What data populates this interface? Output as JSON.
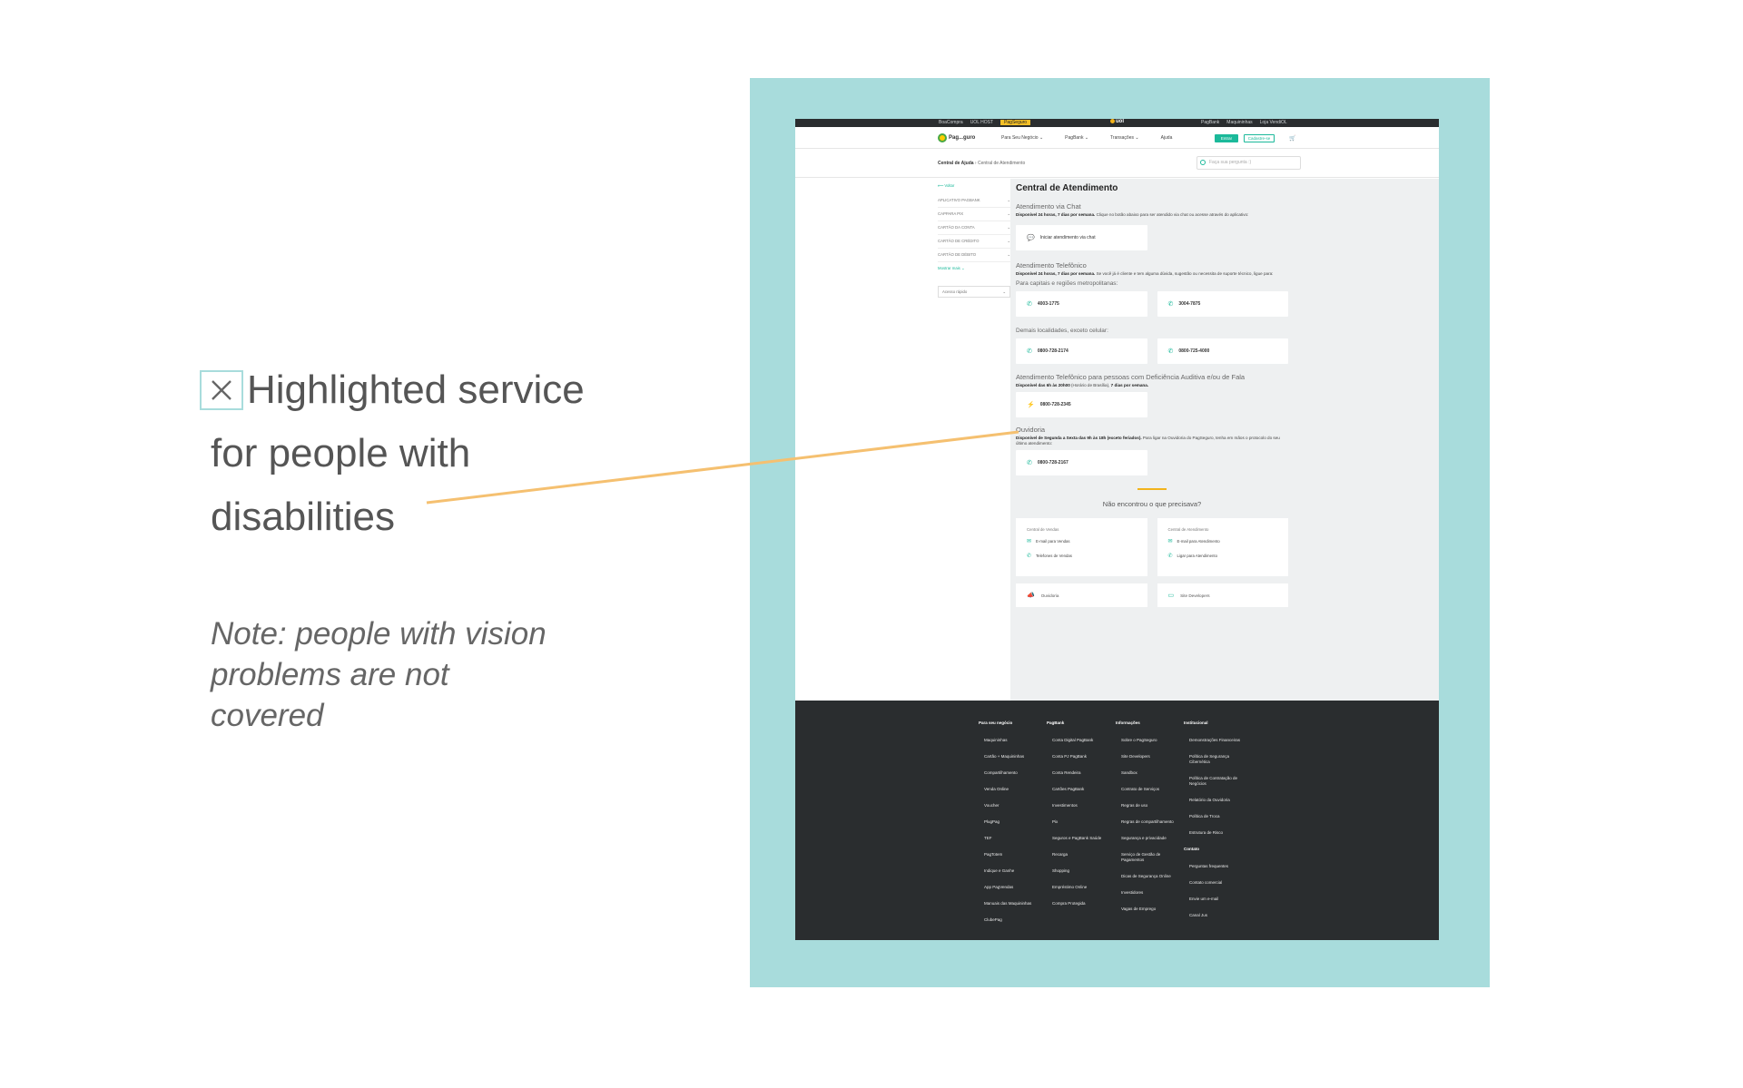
{
  "annotation": {
    "line1": "Highlighted service",
    "line2": "for people with",
    "line3": "disabilities",
    "note": "Note: people with vision problems are not covered",
    "colors": {
      "frame": "#a8dcdc",
      "connector": "#f5c070",
      "text": "#555555"
    }
  },
  "topbar": {
    "left_links": [
      "BoaCompra",
      "UOL HOST",
      "PagSeguro"
    ],
    "logo": "uol",
    "right_links": [
      "PagBank",
      "Maquininhas",
      "Loja VendiOL"
    ]
  },
  "header": {
    "brand": "Pag...guro",
    "nav": [
      "Para Seu Negócio ⌄",
      "PagBank ⌄",
      "Transações ⌄",
      "Ajuda"
    ],
    "login_label": "Entrar",
    "signup_label": "Cadastre-se",
    "cart_icon": "cart-icon"
  },
  "subheader": {
    "breadcrumb_root": "Central de Ajuda",
    "breadcrumb_current": "Central de Atendimento",
    "search_placeholder": "Faça sua pergunta :)"
  },
  "sidebar": {
    "back": "⟵ Voltar",
    "items": [
      "APLICATIVO PAGBANK",
      "CAPPARA PIX",
      "CARTÃO DA CONTA",
      "CARTÃO DE CRÉDITO",
      "CARTÃO DE DÉBITO"
    ],
    "more": "Mostrar mais ⌄",
    "select_value": "Acesso rápido"
  },
  "main": {
    "title": "Central de Atendimento",
    "chat": {
      "title": "Atendimento via Chat",
      "desc_bold": "Disponível 24 horas, 7 dias por semana.",
      "desc": " Clique no botão abaixo para ser atendido via chat ou acesse através do aplicativo:",
      "button": "Iniciar atendimento via chat"
    },
    "phone": {
      "title": "Atendimento Telefônico",
      "desc_bold": "Disponível 24 horas, 7 dias por semana.",
      "desc": " Se você já é cliente e tem alguma dúvida, sugestão ou necessita de suporte técnico, ligue para:",
      "capitals_label": "Para capitais e regiões metropolitanas:",
      "capitals": [
        "4003-1775",
        "3004-7875"
      ],
      "others_label": "Demais localidades, exceto celular:",
      "others": [
        "0800-728-2174",
        "0800-725-4000"
      ]
    },
    "accessible": {
      "title": "Atendimento Telefônico para pessoas com Deficiência Auditiva e/ou de Fala",
      "desc_bold": "Disponível das 6h às 20h00",
      "desc": " (Horário de Brasília),",
      "desc_bold2": " 7 dias por semana.",
      "phone": "0800-728-2345"
    },
    "ombudsman": {
      "title": "Ouvidoria",
      "desc_bold": "Disponível de Segunda a Sexta das 9h às 18h (exceto feriados).",
      "desc": " Para ligar na Ouvidoria do PagSeguro, tenha em mãos o protocolo do seu último atendimento:",
      "phone": "0800-728-2167"
    },
    "not_found": {
      "title": "Não encontrou o que precisava?",
      "sales": {
        "title": "Central de Vendas",
        "email": "E-mail para Vendas",
        "phones": "Telefones de Vendas"
      },
      "support": {
        "title": "Central de Atendimento",
        "email": "E-mail para Atendimento",
        "call": "Ligar para Atendimento"
      },
      "ouvidoria": "Ouvidoria",
      "developers": "Site Developers"
    }
  },
  "footer": {
    "col1": {
      "title": "Para seu negócio",
      "items": [
        "Maquininhas",
        "Cartão + Maquininhas",
        "Compartilhamento",
        "Venda Online",
        "Voucher",
        "PlugPag",
        "TEF",
        "PagTotem",
        "Indique e Ganhe",
        "App PagVendas",
        "Manuais das Maquininhas",
        "ClubePag"
      ]
    },
    "col2": {
      "title": "PagBank",
      "items": [
        "Conta Digital PagBank",
        "Conta PJ PagBank",
        "Conta Rendeira",
        "Cartões PagBank",
        "Investimentos",
        "Pix",
        "Seguros e PagBank Saúde",
        "Recarga",
        "Shopping",
        "Empréstimo Online",
        "Compra Protegida"
      ]
    },
    "col3": {
      "title": "Informações",
      "items": [
        "Sobre o PagSeguro",
        "Site Developers",
        "Sandbox",
        "Contrato de Serviços",
        "Regras de uso",
        "Regras de compartilhamento",
        "Segurança e privacidade",
        "Serviço de Gestão de Pagamentos",
        "Dicas de Segurança Online",
        "Investidores",
        "Vagas de Emprego"
      ]
    },
    "col4": {
      "title": "Institucional",
      "items": [
        "Demonstrações Financeiras",
        "Política de Segurança Cibernética",
        "Política de Contratação de Negócios",
        "Relatório da Ouvidoria",
        "Política de Troca",
        "Estrutura de Risco"
      ],
      "title2": "Contato",
      "items2": [
        "Perguntas frequentes",
        "Contato comercial",
        "Envie um e-mail",
        "Canal Jus"
      ]
    }
  }
}
